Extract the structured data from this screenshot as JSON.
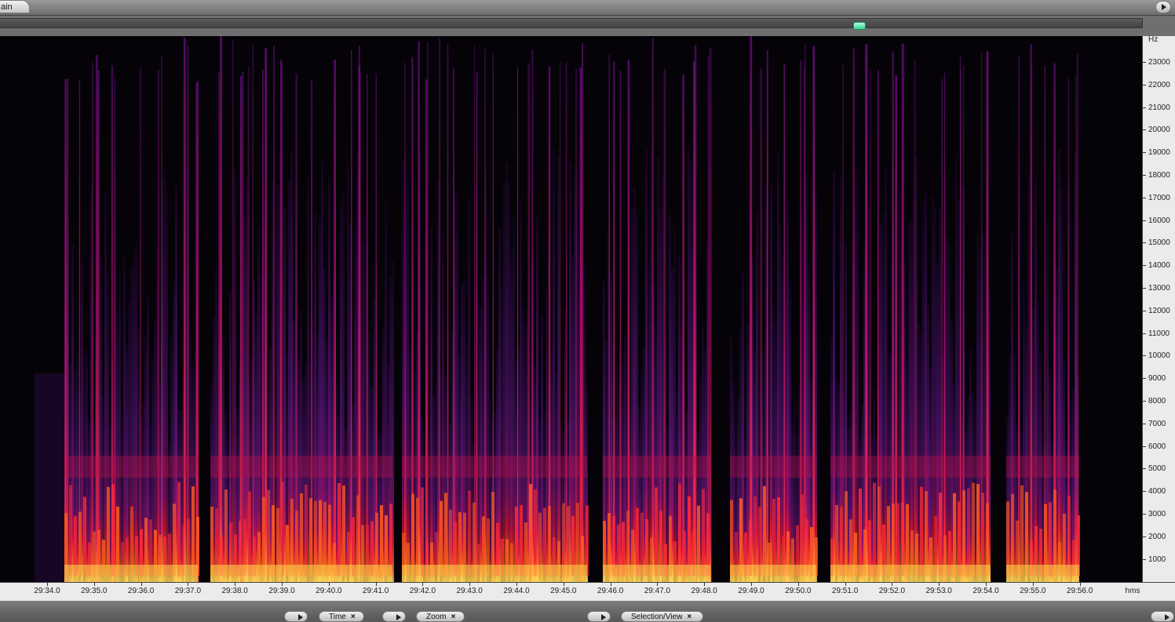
{
  "header": {
    "tab_label": "ain"
  },
  "spectrogram": {
    "freq_unit": "Hz",
    "freq_labels": [
      "23000",
      "22000",
      "21000",
      "20000",
      "19000",
      "18000",
      "17000",
      "16000",
      "15000",
      "14000",
      "13000",
      "12000",
      "11000",
      "10000",
      "9000",
      "8000",
      "7000",
      "6000",
      "5000",
      "4000",
      "3000",
      "2000",
      "1000"
    ],
    "time_unit": "hms",
    "time_labels": [
      "29:34.0",
      "29:35.0",
      "29:36.0",
      "29:37.0",
      "29:38.0",
      "29:39.0",
      "29:40.0",
      "29:41.0",
      "29:42.0",
      "29:43.0",
      "29:44.0",
      "29:45.0",
      "29:46.0",
      "29:47.0",
      "29:48.0",
      "29:49.0",
      "29:50.0",
      "29:51.0",
      "29:52.0",
      "29:53.0",
      "29:54.0",
      "29:55.0",
      "29:56.0"
    ]
  },
  "bottom_panel": {
    "time_label": "Time",
    "zoom_label": "Zoom",
    "selection_label": "Selection/View",
    "close_glyph": "×"
  },
  "colors": {
    "accent_thumb": "#3cd49a",
    "spectro_low": "#2a0a3a",
    "spectro_mid": "#d0104a",
    "spectro_high": "#ffd040"
  }
}
